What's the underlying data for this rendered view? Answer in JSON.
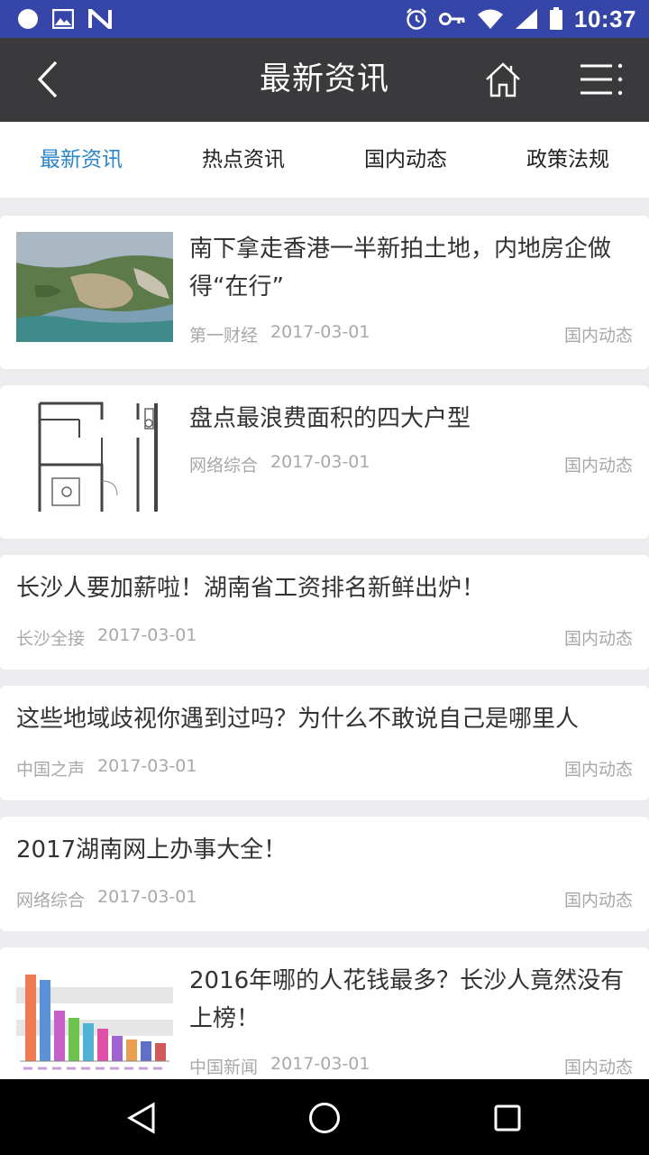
{
  "status_bar": {
    "time": "10:37",
    "left_icons": [
      "notification-dot-icon",
      "image-icon",
      "n-icon"
    ],
    "right_icons": [
      "alarm-icon",
      "key-icon",
      "wifi-icon",
      "signal-icon",
      "battery-icon"
    ]
  },
  "app_bar": {
    "title": "最新资讯",
    "back_icon": "chevron-left-icon",
    "home_icon": "home-icon",
    "menu_icon": "menu-icon"
  },
  "tabs": [
    {
      "label": "最新资讯",
      "active": true
    },
    {
      "label": "热点资讯",
      "active": false
    },
    {
      "label": "国内动态",
      "active": false
    },
    {
      "label": "政策法规",
      "active": false
    }
  ],
  "articles": [
    {
      "title": "南下拿走香港一半新拍土地，内地房企做得“在行”",
      "source": "第一财经",
      "date": "2017-03-01",
      "category": "国内动态"
    },
    {
      "title": "盘点最浪费面积的四大户型",
      "source": "网络综合",
      "date": "2017-03-01",
      "category": "国内动态"
    },
    {
      "title": "长沙人要加薪啦！湖南省工资排名新鲜出炉！",
      "source": "长沙全接",
      "date": "2017-03-01",
      "category": "国内动态"
    },
    {
      "title": "这些地域歧视你遇到过吗？为什么不敢说自己是哪里人",
      "source": "中国之声",
      "date": "2017-03-01",
      "category": "国内动态"
    },
    {
      "title": "2017湖南网上办事大全！",
      "source": "网络综合",
      "date": "2017-03-01",
      "category": "国内动态"
    },
    {
      "title": "2016年哪的人花钱最多？长沙人竟然没有上榜！",
      "source": "中国新闻",
      "date": "2017-03-01",
      "category": "国内动态"
    }
  ],
  "colors": {
    "status_bar": "#3545a8",
    "app_bar": "#3a3a3c",
    "active_tab": "#2a86c8",
    "background": "#ececee"
  },
  "nav_bar": {
    "icons": [
      "back-triangle-icon",
      "home-circle-icon",
      "recents-square-icon"
    ]
  }
}
